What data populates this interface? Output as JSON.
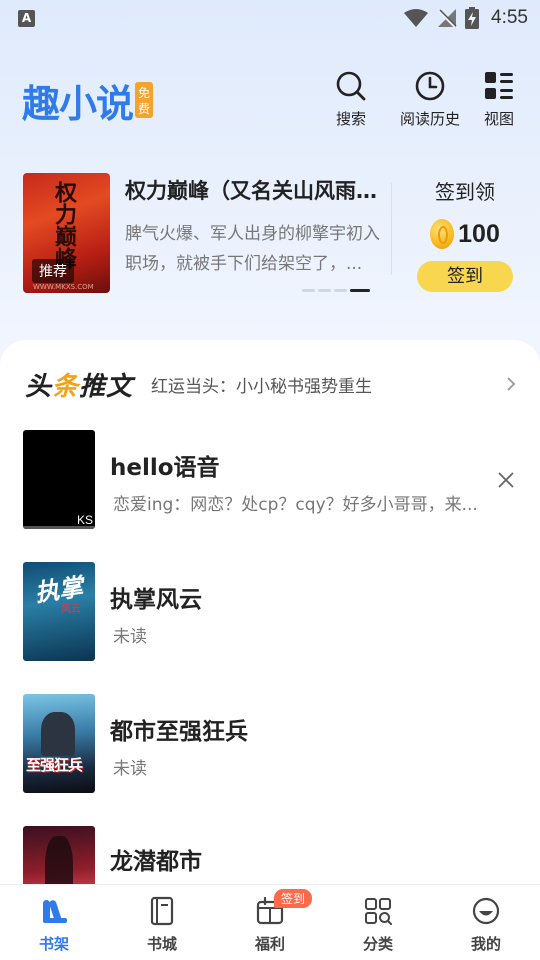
{
  "status_bar": {
    "time": "4:55",
    "notif_letter": "A"
  },
  "header": {
    "logo_text": "趣小说",
    "logo_badge": [
      "免",
      "费"
    ],
    "actions": [
      {
        "label": "搜索",
        "icon": "search-icon"
      },
      {
        "label": "阅读历史",
        "icon": "clock-icon"
      },
      {
        "label": "视图",
        "icon": "grid-view-icon"
      }
    ]
  },
  "banner": {
    "cover_title": "权力巅峰",
    "cover_tag": "推荐",
    "cover_site": "WWW.MKXS.COM",
    "title": "权力巅峰（又名关山风雨路...",
    "description": "脾气火爆、军人出身的柳擎宇初入职场，就被手下们给架空了，...",
    "dots_total": 4,
    "dots_active_index": 3
  },
  "checkin": {
    "title": "签到领",
    "amount": "100",
    "button": "签到"
  },
  "headline": {
    "logo_part1": "头",
    "logo_accent": "条",
    "logo_part2": "推文",
    "text": "红运当头：小小秘书强势重生"
  },
  "books": [
    {
      "title": "hello语音",
      "subtitle": "恋爱ing：网恋？处cp？cqy？好多小哥哥，来...",
      "cover_tag": "KS",
      "dismissable": true
    },
    {
      "title": "执掌风云",
      "subtitle": "未读",
      "cover_text": "执掌",
      "cover_side": "风云"
    },
    {
      "title": "都市至强狂兵",
      "subtitle": "未读",
      "cover_text": "至强狂兵"
    },
    {
      "title": "龙潜都市",
      "subtitle": ""
    }
  ],
  "bottom_nav": [
    {
      "label": "书架",
      "icon": "bookshelf-icon",
      "active": true
    },
    {
      "label": "书城",
      "icon": "book-icon",
      "active": false
    },
    {
      "label": "福利",
      "icon": "gift-calendar-icon",
      "active": false,
      "badge": "签到"
    },
    {
      "label": "分类",
      "icon": "category-grid-icon",
      "active": false
    },
    {
      "label": "我的",
      "icon": "profile-icon",
      "active": false
    }
  ],
  "colors": {
    "brand_blue": "#2f7bea",
    "accent_yellow": "#f8d64e",
    "badge_orange": "#f4a32c",
    "badge_red": "#ff6a4a"
  }
}
